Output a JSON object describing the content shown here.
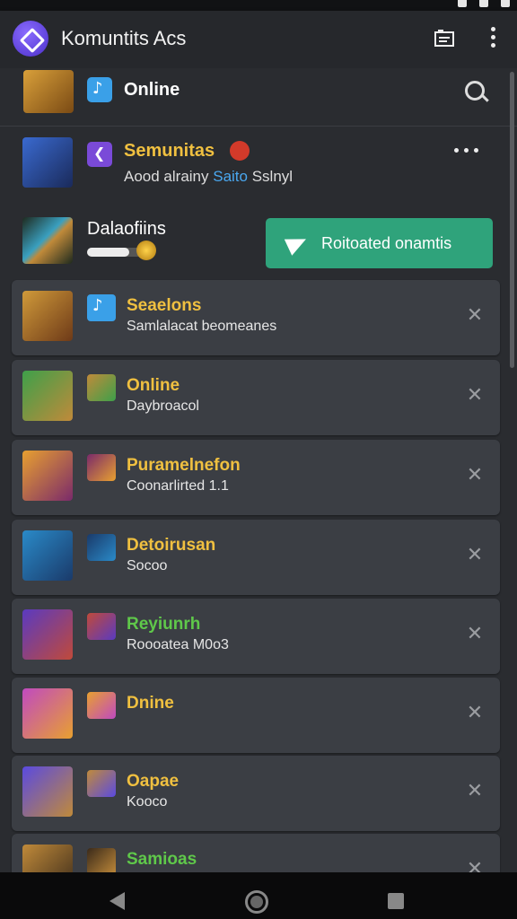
{
  "app": {
    "title": "Komuntits Acs"
  },
  "online_row": {
    "label": "Online"
  },
  "featured": {
    "title": "Semunitas",
    "sub_prefix": "Aood alrainy ",
    "sub_highlight": "Saito",
    "sub_suffix": " Sslnyl"
  },
  "downloads": {
    "label": "Dalaofiins",
    "progress": 0.65,
    "button_label": "Roitoated onamtis"
  },
  "items": [
    {
      "title": "Seaelons",
      "sub": "Samlalacat beomeanes",
      "title_color": "#f0c040",
      "art": [
        "#d09a3a",
        "#6e3a18"
      ],
      "mini": "blue-app"
    },
    {
      "title": "Online",
      "sub": "Daybroacol",
      "title_color": "#f0c040",
      "art": [
        "#3ea04a",
        "#c08a3a"
      ],
      "mini": "portrait"
    },
    {
      "title": "Puramelnefon",
      "sub": "Coonarlirted 1.1",
      "title_color": "#f0c040",
      "art": [
        "#e8a030",
        "#7a2a6a"
      ],
      "mini": "portrait"
    },
    {
      "title": "Detoirusan",
      "sub": "Socoo",
      "title_color": "#f0c040",
      "art": [
        "#2a8ac8",
        "#1a3a6a"
      ],
      "mini": "portrait"
    },
    {
      "title": "Reyiunrh",
      "sub": "Roooatea M0o3",
      "title_color": "#5fc84a",
      "art": [
        "#5a3ac0",
        "#c04a3a"
      ],
      "mini": "portrait"
    },
    {
      "title": "Dnine",
      "sub": "",
      "title_color": "#f0c040",
      "art": [
        "#c04ac0",
        "#e8a030"
      ],
      "mini": "portrait"
    },
    {
      "title": "Oapae",
      "sub": "Kooco",
      "title_color": "#f0c040",
      "art": [
        "#5a4ae0",
        "#c08a3a"
      ],
      "mini": "portrait"
    },
    {
      "title": "Samioas",
      "sub": "",
      "title_color": "#5fc84a",
      "art": [
        "#c08a3a",
        "#3a2a1a"
      ],
      "mini": "portrait"
    }
  ]
}
